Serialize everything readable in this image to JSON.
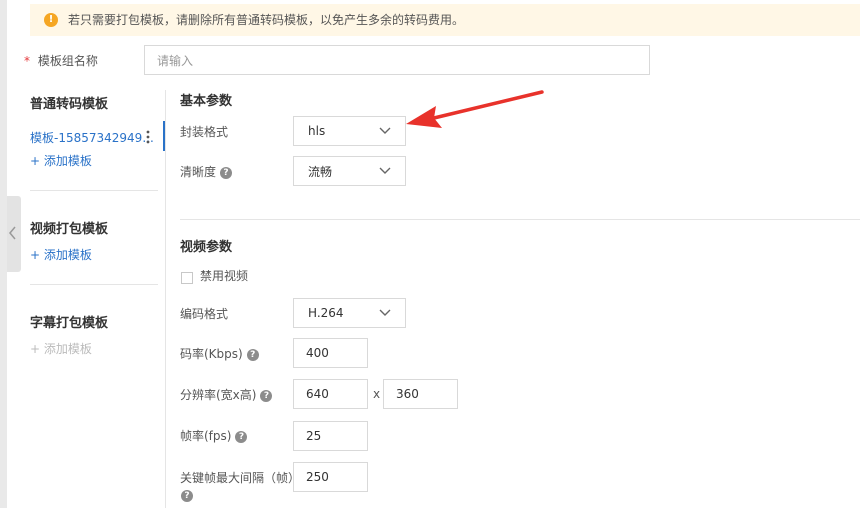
{
  "banner": {
    "text": "若只需要打包模板，请删除所有普通转码模板，以免产生多余的转码费用。"
  },
  "template_group": {
    "label": "模板组名称",
    "required_mark": "*",
    "placeholder": "请输入"
  },
  "sidebar": {
    "normal": {
      "title": "普通转码模板",
      "item": "模板-15857342949...",
      "add": "+ 添加模板"
    },
    "video_pack": {
      "title": "视频打包模板",
      "add": "+ 添加模板"
    },
    "subtitle_pack": {
      "title": "字幕打包模板",
      "add": "+ 添加模板"
    }
  },
  "basic": {
    "title": "基本参数",
    "format_label": "封装格式",
    "format_value": "hls",
    "quality_label": "清晰度",
    "quality_value": "流畅"
  },
  "video": {
    "title": "视频参数",
    "disable_label": "禁用视频",
    "codec_label": "编码格式",
    "codec_value": "H.264",
    "bitrate_label": "码率(Kbps)",
    "bitrate_value": "400",
    "resolution_label": "分辨率(宽x高)",
    "width_value": "640",
    "times": "x",
    "height_value": "360",
    "fps_label": "帧率(fps)",
    "fps_value": "25",
    "gop_label": "关键帧最大间隔（帧）",
    "gop_value": "250"
  },
  "colors": {
    "link": "#2a72c8",
    "required": "#e4393c",
    "annotation_arrow": "#e8322b",
    "warning": "#f5a623"
  }
}
